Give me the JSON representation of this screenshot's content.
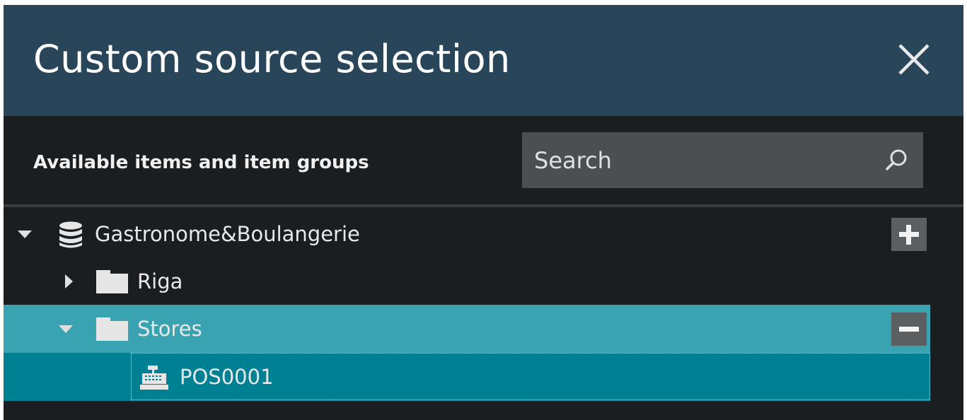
{
  "dialog": {
    "title": "Custom source selection",
    "close_icon": "close-icon"
  },
  "panel": {
    "label": "Available items and item groups",
    "search": {
      "placeholder": "Search",
      "value": ""
    }
  },
  "tree": {
    "root": {
      "label": "Gastronome&Boulangerie",
      "icon": "database-icon",
      "expanded": true,
      "action": "add"
    },
    "riga": {
      "label": "Riga",
      "icon": "folder-icon",
      "expanded": false
    },
    "stores": {
      "label": "Stores",
      "icon": "folder-icon",
      "expanded": true,
      "action": "remove",
      "selected": true
    },
    "pos": {
      "label": "POS0001",
      "icon": "cash-register-icon",
      "focused": true
    }
  },
  "colors": {
    "header_bg": "#28455a",
    "body_bg": "#1b1e21",
    "selected_row": "#3aa3b1",
    "focused_row": "#008193",
    "search_bg": "#4b4f52",
    "button_bg": "#5b5f62"
  }
}
